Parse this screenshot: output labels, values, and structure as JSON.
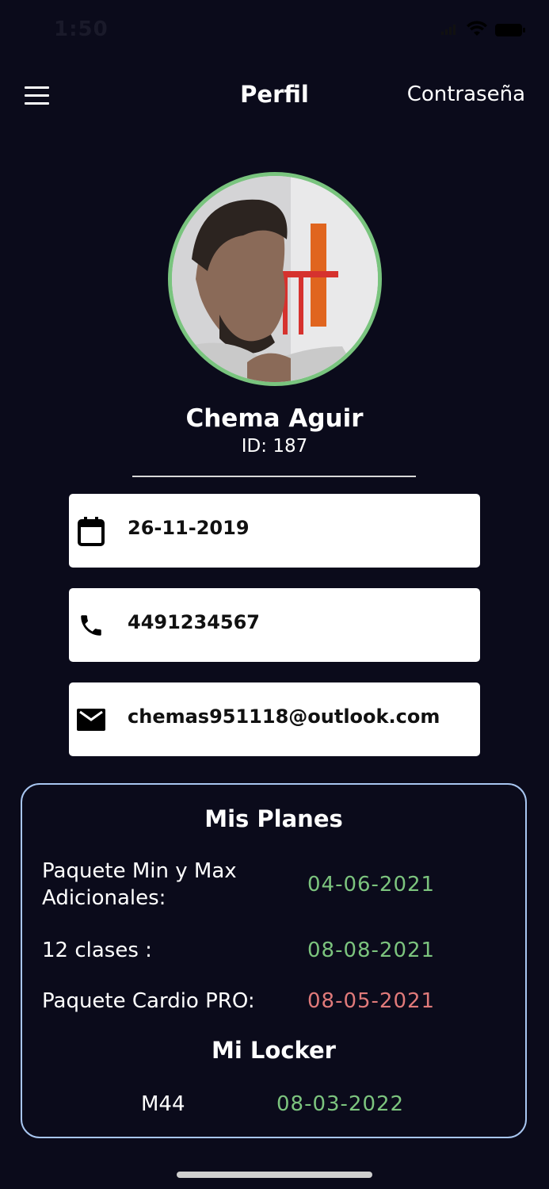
{
  "status_bar": {
    "time": "1:50"
  },
  "nav": {
    "title": "Perfil",
    "action_label": "Contraseña",
    "menu_icon": "hamburger-icon"
  },
  "profile": {
    "name": "Chema Aguir",
    "id_text": "ID: 187",
    "avatar_ring_color": "#79c47e"
  },
  "fields": {
    "birthdate": {
      "icon": "calendar-icon",
      "value": "26-11-2019"
    },
    "phone": {
      "icon": "phone-icon",
      "value": "4491234567"
    },
    "email": {
      "icon": "mail-icon",
      "value": "chemas951118@outlook.com"
    }
  },
  "plans": {
    "title": "Mis Planes",
    "items": [
      {
        "name": "Paquete Min y Max Adicionales:",
        "date": "04-06-2021",
        "status": "active"
      },
      {
        "name": "12 clases :",
        "date": "08-08-2021",
        "status": "active"
      },
      {
        "name": "Paquete Cardio PRO:",
        "date": "08-05-2021",
        "status": "expired"
      }
    ],
    "active_color": "#7cc47e",
    "expired_color": "#e07a7a"
  },
  "locker": {
    "title": "Mi Locker",
    "code": "M44",
    "date": "08-03-2022"
  },
  "colors": {
    "background": "#0b0b1b",
    "card_border": "#a8c6f0",
    "field_background": "#ffffff"
  }
}
